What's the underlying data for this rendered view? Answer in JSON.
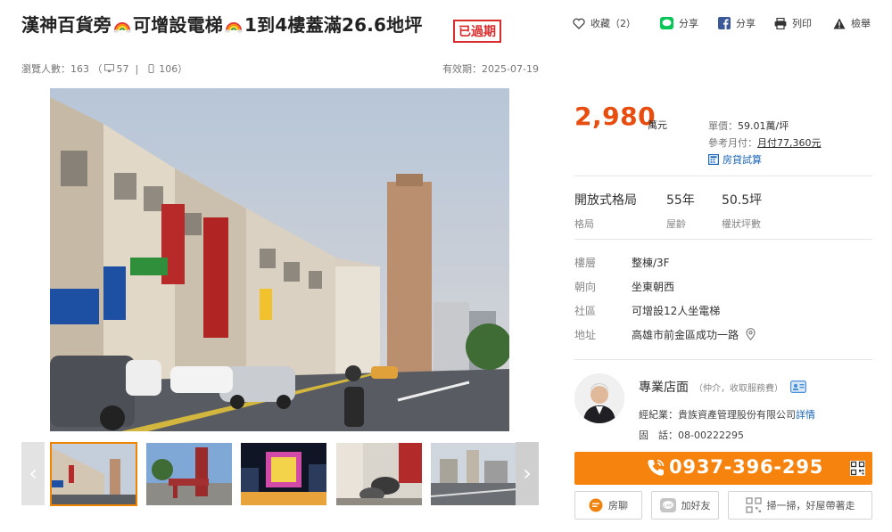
{
  "listing": {
    "title_part1": "漢神百貨旁",
    "title_part2": "可增設電梯",
    "title_part3": "1到4樓蓋滿26.6地坪",
    "expired_badge": "已過期",
    "views_label": "瀏覽人數：163",
    "views_open_paren": "（",
    "views_desktop": "57",
    "views_separator": "|",
    "views_mobile": "106",
    "views_close_paren": "）",
    "valid_label": "有效期：2025-07-19"
  },
  "actions": {
    "favorite": "收藏（2）",
    "line_share": "分享",
    "fb_share": "分享",
    "print": "列印",
    "report": "檢舉"
  },
  "price": {
    "value": "2,980",
    "unit": "萬元",
    "unit_price_label": "單價：",
    "unit_price_value": "59.01萬/坪",
    "monthly_label": "參考月付：",
    "monthly_value": "月付77,360元",
    "loan_calc": "房貸試算"
  },
  "specs": [
    {
      "value": "開放式格局",
      "key": "格局"
    },
    {
      "value": "55年",
      "key": "屋齡"
    },
    {
      "value": "50.5坪",
      "key": "權狀坪數"
    }
  ],
  "info": [
    {
      "key": "樓層",
      "value": "整棟/3F"
    },
    {
      "key": "朝向",
      "value": "坐東朝西"
    },
    {
      "key": "社區",
      "value": "可增設12人坐電梯"
    },
    {
      "key": "地址",
      "value": "高雄市前金區成功一路"
    }
  ],
  "agent": {
    "name": "專業店面",
    "note": "（仲介，收取服務費）",
    "agent_label": "經紀業：",
    "company": "貴族資產管理股份有限公司",
    "details_link": "詳情",
    "phone_label": "固　話：",
    "landline": "08-00222295"
  },
  "contact": {
    "mobile": "0937-396-295",
    "chat": "房聊",
    "add_friend": "加好友",
    "scan": "掃一掃，好屋帶著走"
  },
  "gallery": {
    "prev": "‹",
    "next": "›",
    "thumbs": [
      {
        "name": "thumb-street-view",
        "active": true
      },
      {
        "name": "thumb-gate",
        "active": false
      },
      {
        "name": "thumb-night-building",
        "active": false
      },
      {
        "name": "thumb-scooter-arcade",
        "active": false
      },
      {
        "name": "thumb-city-view",
        "active": false
      }
    ]
  },
  "colors": {
    "price": "#e84c0e",
    "accent_orange": "#f7830f",
    "link_blue": "#1a64b6",
    "expired_red": "#d92c2c",
    "line_green": "#06c755",
    "facebook_blue": "#3b5998"
  }
}
